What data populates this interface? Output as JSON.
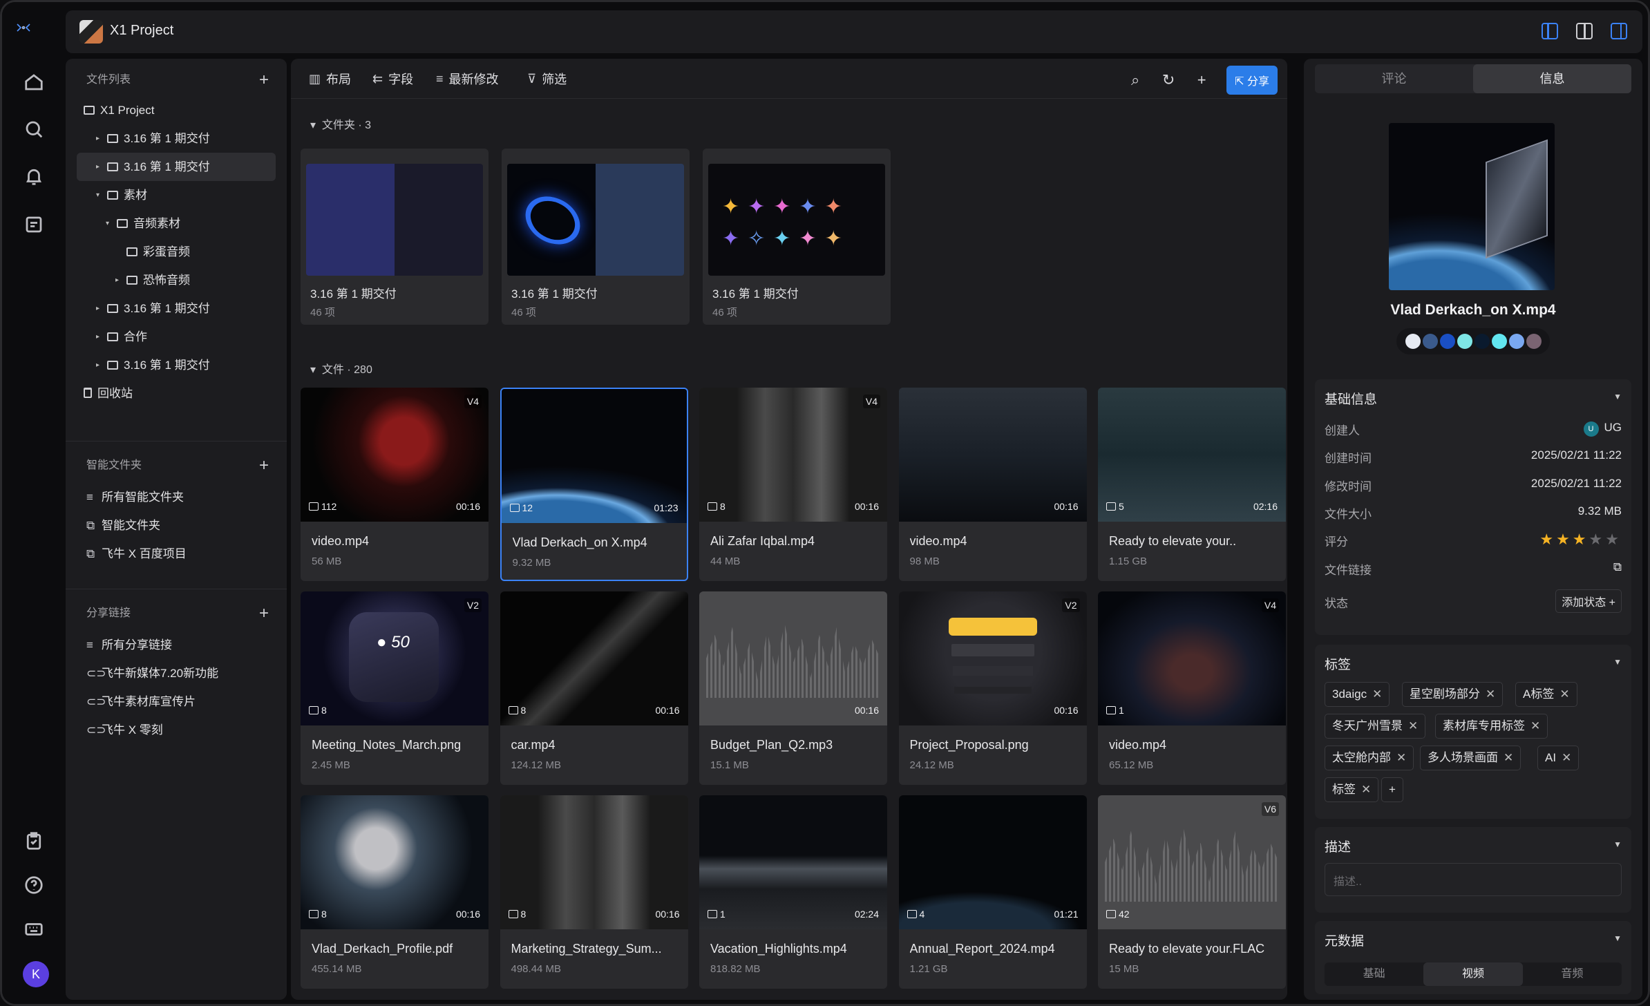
{
  "app": {
    "project_title": "X1 Project",
    "user_initial": "K"
  },
  "toolbar": {
    "layout": "布局",
    "fields": "字段",
    "sort": "最新修改",
    "filter": "筛选",
    "share": "分享"
  },
  "sidebar": {
    "files_header": "文件列表",
    "tree": [
      {
        "label": "X1 Project",
        "indent": 0,
        "arrow": "",
        "icon": "folder"
      },
      {
        "label": "3.16 第 1 期交付",
        "indent": 1,
        "arrow": "▸"
      },
      {
        "label": "3.16 第 1 期交付",
        "indent": 1,
        "arrow": "▸",
        "selected": true
      },
      {
        "label": "素材",
        "indent": 1,
        "arrow": "▾"
      },
      {
        "label": "音频素材",
        "indent": 2,
        "arrow": "▾"
      },
      {
        "label": "彩蛋音频",
        "indent": 3,
        "arrow": ""
      },
      {
        "label": "恐怖音频",
        "indent": 3,
        "arrow": "▸"
      },
      {
        "label": "3.16 第 1 期交付",
        "indent": 1,
        "arrow": "▸"
      },
      {
        "label": "合作",
        "indent": 1,
        "arrow": "▸"
      },
      {
        "label": "3.16 第 1 期交付",
        "indent": 1,
        "arrow": "▸"
      },
      {
        "label": "回收站",
        "indent": 0,
        "arrow": "",
        "icon": "trash"
      }
    ],
    "smart_header": "智能文件夹",
    "smart_items": [
      "所有智能文件夹",
      "智能文件夹",
      "飞牛 X 百度项目"
    ],
    "share_header": "分享链接",
    "share_items": [
      "所有分享链接",
      "飞牛新媒体7.20新功能",
      "飞牛素材库宣传片",
      "飞牛 X 零刻"
    ]
  },
  "main": {
    "folders_header": "文件夹 · 3",
    "files_header": "文件 · 280",
    "folders": [
      {
        "name": "3.16 第 1 期交付",
        "count": "46 项"
      },
      {
        "name": "3.16 第 1 期交付",
        "count": "46 项"
      },
      {
        "name": "3.16 第 1 期交付",
        "count": "46 项"
      }
    ],
    "files": [
      {
        "name": "video.mp4",
        "size": "56 MB",
        "ver": "V4",
        "comments": "112",
        "duration": "00:16",
        "theme": "racer"
      },
      {
        "name": "Vlad Derkach_on X.mp4",
        "size": "9.32 MB",
        "ver": "",
        "comments": "12",
        "duration": "01:23",
        "theme": "earth",
        "selected": true
      },
      {
        "name": "Ali Zafar Iqbal.mp4",
        "size": "44 MB",
        "ver": "V4",
        "comments": "8",
        "duration": "00:16",
        "theme": "ruin"
      },
      {
        "name": "video.mp4",
        "size": "98 MB",
        "ver": "",
        "comments": "",
        "duration": "00:16",
        "theme": "city"
      },
      {
        "name": "Ready to elevate your..",
        "size": "1.15 GB",
        "ver": "",
        "comments": "5",
        "duration": "02:16",
        "theme": "fog"
      },
      {
        "name": "Meeting_Notes_March.png",
        "size": "2.45 MB",
        "ver": "V2",
        "comments": "8",
        "duration": "",
        "theme": "device"
      },
      {
        "name": "car.mp4",
        "size": "124.12 MB",
        "ver": "",
        "comments": "8",
        "duration": "00:16",
        "theme": "car"
      },
      {
        "name": "Budget_Plan_Q2.mp3",
        "size": "15.1 MB",
        "ver": "",
        "comments": "",
        "duration": "00:16",
        "theme": "wave"
      },
      {
        "name": "Project_Proposal.png",
        "size": "24.12 MB",
        "ver": "V2",
        "comments": "",
        "duration": "00:16",
        "theme": "ui"
      },
      {
        "name": "video.mp4",
        "size": "65.12 MB",
        "ver": "V4",
        "comments": "1",
        "duration": "",
        "theme": "interior"
      },
      {
        "name": "Vlad_Derkach_Profile.pdf",
        "size": "455.14 MB",
        "ver": "",
        "comments": "8",
        "duration": "00:16",
        "theme": "astro"
      },
      {
        "name": "Marketing_Strategy_Sum...",
        "size": "498.44 MB",
        "ver": "",
        "comments": "8",
        "duration": "00:16",
        "theme": "ruin"
      },
      {
        "name": "Vacation_Highlights.mp4",
        "size": "818.82 MB",
        "ver": "",
        "comments": "1",
        "duration": "02:24",
        "theme": "snow"
      },
      {
        "name": "Annual_Report_2024.mp4",
        "size": "1.21 GB",
        "ver": "",
        "comments": "4",
        "duration": "01:21",
        "theme": "planet"
      },
      {
        "name": "Ready to elevate your.FLAC",
        "size": "15 MB",
        "ver": "V6",
        "comments": "42",
        "duration": "",
        "theme": "wave"
      }
    ]
  },
  "right": {
    "tabs": [
      "评论",
      "信息"
    ],
    "file_name": "Vlad Derkach_on X.mp4",
    "swatches": [
      "#e6eaf2",
      "#3a5a8c",
      "#1a4fc4",
      "#7ee6e6",
      "#0a1a2e",
      "#62e6f0",
      "#7aa8f0",
      "#7a6472"
    ],
    "basic_header": "基础信息",
    "basic": [
      {
        "k": "创建人",
        "v": "UG"
      },
      {
        "k": "创建时间",
        "v": "2025/02/21 11:22"
      },
      {
        "k": "修改时间",
        "v": "2025/02/21 11:22"
      },
      {
        "k": "文件大小",
        "v": "9.32 MB"
      },
      {
        "k": "评分",
        "v": ""
      },
      {
        "k": "文件链接",
        "v": ""
      },
      {
        "k": "状态",
        "v": ""
      }
    ],
    "creator_badge": "U",
    "rating": 3,
    "add_state": "添加状态",
    "tags_header": "标签",
    "tags": [
      "3daigc",
      "星空剧场部分",
      "A标签",
      "冬天广州雪景",
      "素材库专用标签",
      "太空舱内部",
      "多人场景画面",
      "AI",
      "标签"
    ],
    "desc_header": "描述",
    "desc_placeholder": "描述..",
    "meta_header": "元数据",
    "meta_tabs": [
      "基础",
      "视频",
      "音频"
    ]
  }
}
